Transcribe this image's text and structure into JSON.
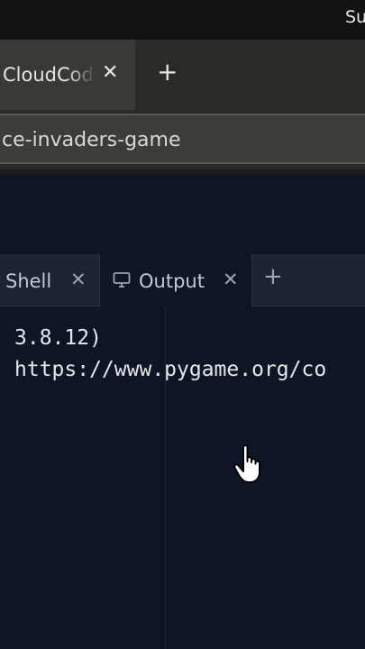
{
  "os": {
    "clock_fragment": "Su"
  },
  "browser": {
    "active_tab_title": "CloudCoder",
    "tab_close_glyph": "✕",
    "new_tab_glyph": "+",
    "url": "ce-invaders-game"
  },
  "panel": {
    "tabs": [
      {
        "label": "Shell",
        "close": "✕",
        "icon": null
      },
      {
        "label": "Output",
        "close": "✕",
        "icon": "monitor-icon"
      }
    ],
    "add_glyph": "+"
  },
  "console": {
    "lines": [
      "3.8.12)",
      "https://www.pygame.org/co"
    ]
  },
  "colors": {
    "background": "#0e1525",
    "panel_tabs": "#1c2333",
    "browser_chrome": "#2b2a27"
  }
}
